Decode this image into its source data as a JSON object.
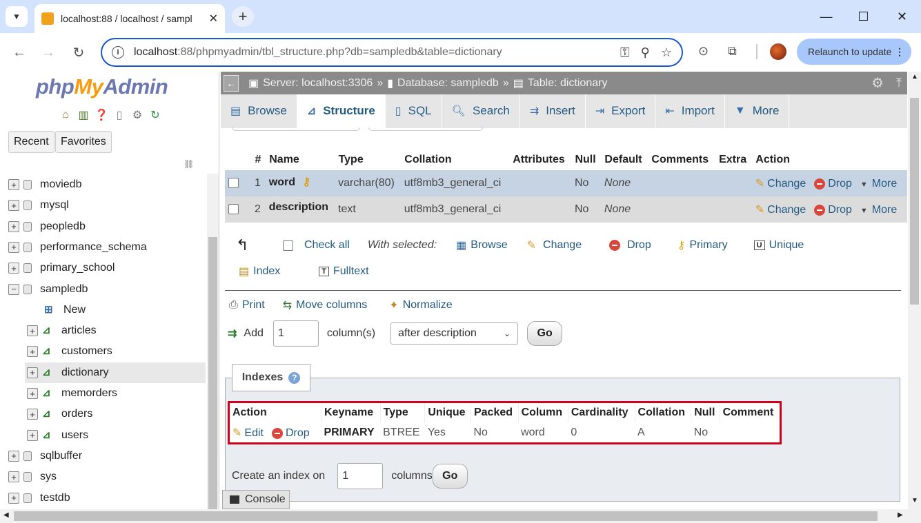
{
  "browser": {
    "tab_title": "localhost:88 / localhost / sampl",
    "url_host": "localhost",
    "url_rest": ":88/phpmyadmin/tbl_structure.php?db=sampledb&table=dictionary",
    "relaunch_label": "Relaunch to update",
    "min_icon": "minimize-icon",
    "max_icon": "maximize-icon",
    "close_icon": "close-icon"
  },
  "logo": {
    "php": "php",
    "my": "My",
    "admin": "Admin"
  },
  "nav_tabs": {
    "recent": "Recent",
    "favorites": "Favorites"
  },
  "tree": [
    {
      "label": "moviedb",
      "type": "db",
      "sign": "+"
    },
    {
      "label": "mysql",
      "type": "db",
      "sign": "+"
    },
    {
      "label": "peopledb",
      "type": "db",
      "sign": "+"
    },
    {
      "label": "performance_schema",
      "type": "db",
      "sign": "+"
    },
    {
      "label": "primary_school",
      "type": "db",
      "sign": "+"
    },
    {
      "label": "sampledb",
      "type": "db",
      "sign": "−"
    },
    {
      "label": "New",
      "type": "new"
    },
    {
      "label": "articles",
      "type": "table",
      "sign": "+"
    },
    {
      "label": "customers",
      "type": "table",
      "sign": "+"
    },
    {
      "label": "dictionary",
      "type": "table",
      "sign": "+",
      "selected": true
    },
    {
      "label": "memorders",
      "type": "table",
      "sign": "+"
    },
    {
      "label": "orders",
      "type": "table",
      "sign": "+"
    },
    {
      "label": "users",
      "type": "table",
      "sign": "+"
    },
    {
      "label": "sqlbuffer",
      "type": "db",
      "sign": "+"
    },
    {
      "label": "sys",
      "type": "db",
      "sign": "+"
    },
    {
      "label": "testdb",
      "type": "db",
      "sign": "+"
    }
  ],
  "breadcrumb": {
    "server": "Server: localhost:3306",
    "database": "Database: sampledb",
    "table": "Table: dictionary",
    "sep": "»"
  },
  "menu": [
    {
      "label": "Browse",
      "icon": "browse-icon"
    },
    {
      "label": "Structure",
      "icon": "structure-icon",
      "active": true
    },
    {
      "label": "SQL",
      "icon": "sql-icon"
    },
    {
      "label": "Search",
      "icon": "search-icon"
    },
    {
      "label": "Insert",
      "icon": "insert-icon"
    },
    {
      "label": "Export",
      "icon": "export-icon"
    },
    {
      "label": "Import",
      "icon": "import-icon"
    },
    {
      "label": "More",
      "icon": "more-caret-icon"
    }
  ],
  "structure": {
    "headers": [
      "#",
      "Name",
      "Type",
      "Collation",
      "Attributes",
      "Null",
      "Default",
      "Comments",
      "Extra",
      "Action"
    ],
    "rows": [
      {
        "num": "1",
        "name": "word",
        "type": "varchar(80)",
        "collation": "utf8mb3_general_ci",
        "attributes": "",
        "null": "No",
        "default": "None",
        "comments": "",
        "extra": "",
        "change": "Change",
        "drop": "Drop",
        "more": "More"
      },
      {
        "num": "2",
        "name": "description",
        "type": "text",
        "collation": "utf8mb3_general_ci",
        "attributes": "",
        "null": "No",
        "default": "None",
        "comments": "",
        "extra": "",
        "change": "Change",
        "drop": "Drop",
        "more": "More"
      }
    ]
  },
  "with_selected": {
    "check_all": "Check all",
    "label": "With selected:",
    "browse": "Browse",
    "change": "Change",
    "drop": "Drop",
    "primary": "Primary",
    "unique": "Unique",
    "index": "Index",
    "fulltext": "Fulltext"
  },
  "actions": {
    "print": "Print",
    "move_columns": "Move columns",
    "normalize": "Normalize"
  },
  "add_columns": {
    "label": "Add",
    "count": "1",
    "suffix": "column(s)",
    "position": "after description",
    "go": "Go"
  },
  "indexes": {
    "legend": "Indexes",
    "headers": [
      "Action",
      "Keyname",
      "Type",
      "Unique",
      "Packed",
      "Column",
      "Cardinality",
      "Collation",
      "Null",
      "Comment"
    ],
    "rows": [
      {
        "edit": "Edit",
        "drop": "Drop",
        "keyname": "PRIMARY",
        "type": "BTREE",
        "unique": "Yes",
        "packed": "No",
        "column": "word",
        "cardinality": "0",
        "collation": "A",
        "null": "No",
        "comment": ""
      }
    ],
    "create_label": "Create an index on",
    "create_count": "1",
    "create_suffix": "columns",
    "go": "Go"
  },
  "console": "Console",
  "colors": {
    "highlight_border": "#d0021b",
    "link": "#235a81",
    "row1": "#c6d3e2",
    "row2": "#dcdcdc"
  }
}
